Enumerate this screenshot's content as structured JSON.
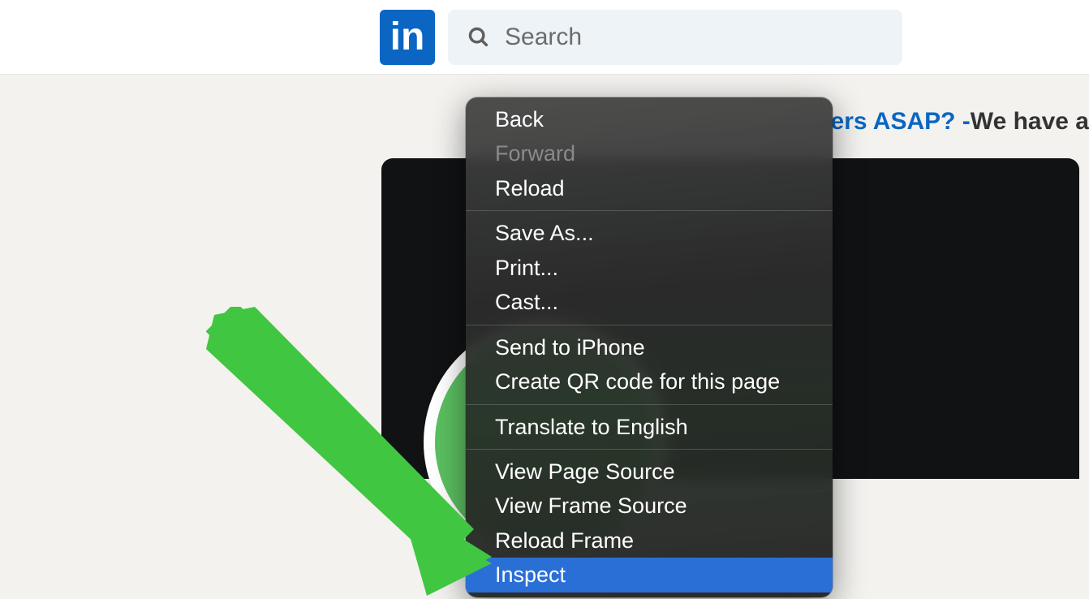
{
  "header": {
    "logo_text": "in",
    "search_placeholder": "Search"
  },
  "banner": {
    "part_blue": "ers ASAP? - ",
    "part_dark": "We have a"
  },
  "context_menu": {
    "groups": [
      [
        {
          "label": "Back",
          "enabled": true
        },
        {
          "label": "Forward",
          "enabled": false
        },
        {
          "label": "Reload",
          "enabled": true
        }
      ],
      [
        {
          "label": "Save As...",
          "enabled": true
        },
        {
          "label": "Print...",
          "enabled": true
        },
        {
          "label": "Cast...",
          "enabled": true
        }
      ],
      [
        {
          "label": "Send to iPhone",
          "enabled": true
        },
        {
          "label": "Create QR code for this page",
          "enabled": true
        }
      ],
      [
        {
          "label": "Translate to English",
          "enabled": true
        }
      ],
      [
        {
          "label": "View Page Source",
          "enabled": true
        },
        {
          "label": "View Frame Source",
          "enabled": true
        },
        {
          "label": "Reload Frame",
          "enabled": true
        },
        {
          "label": "Inspect",
          "enabled": true,
          "highlight": true
        }
      ]
    ]
  }
}
